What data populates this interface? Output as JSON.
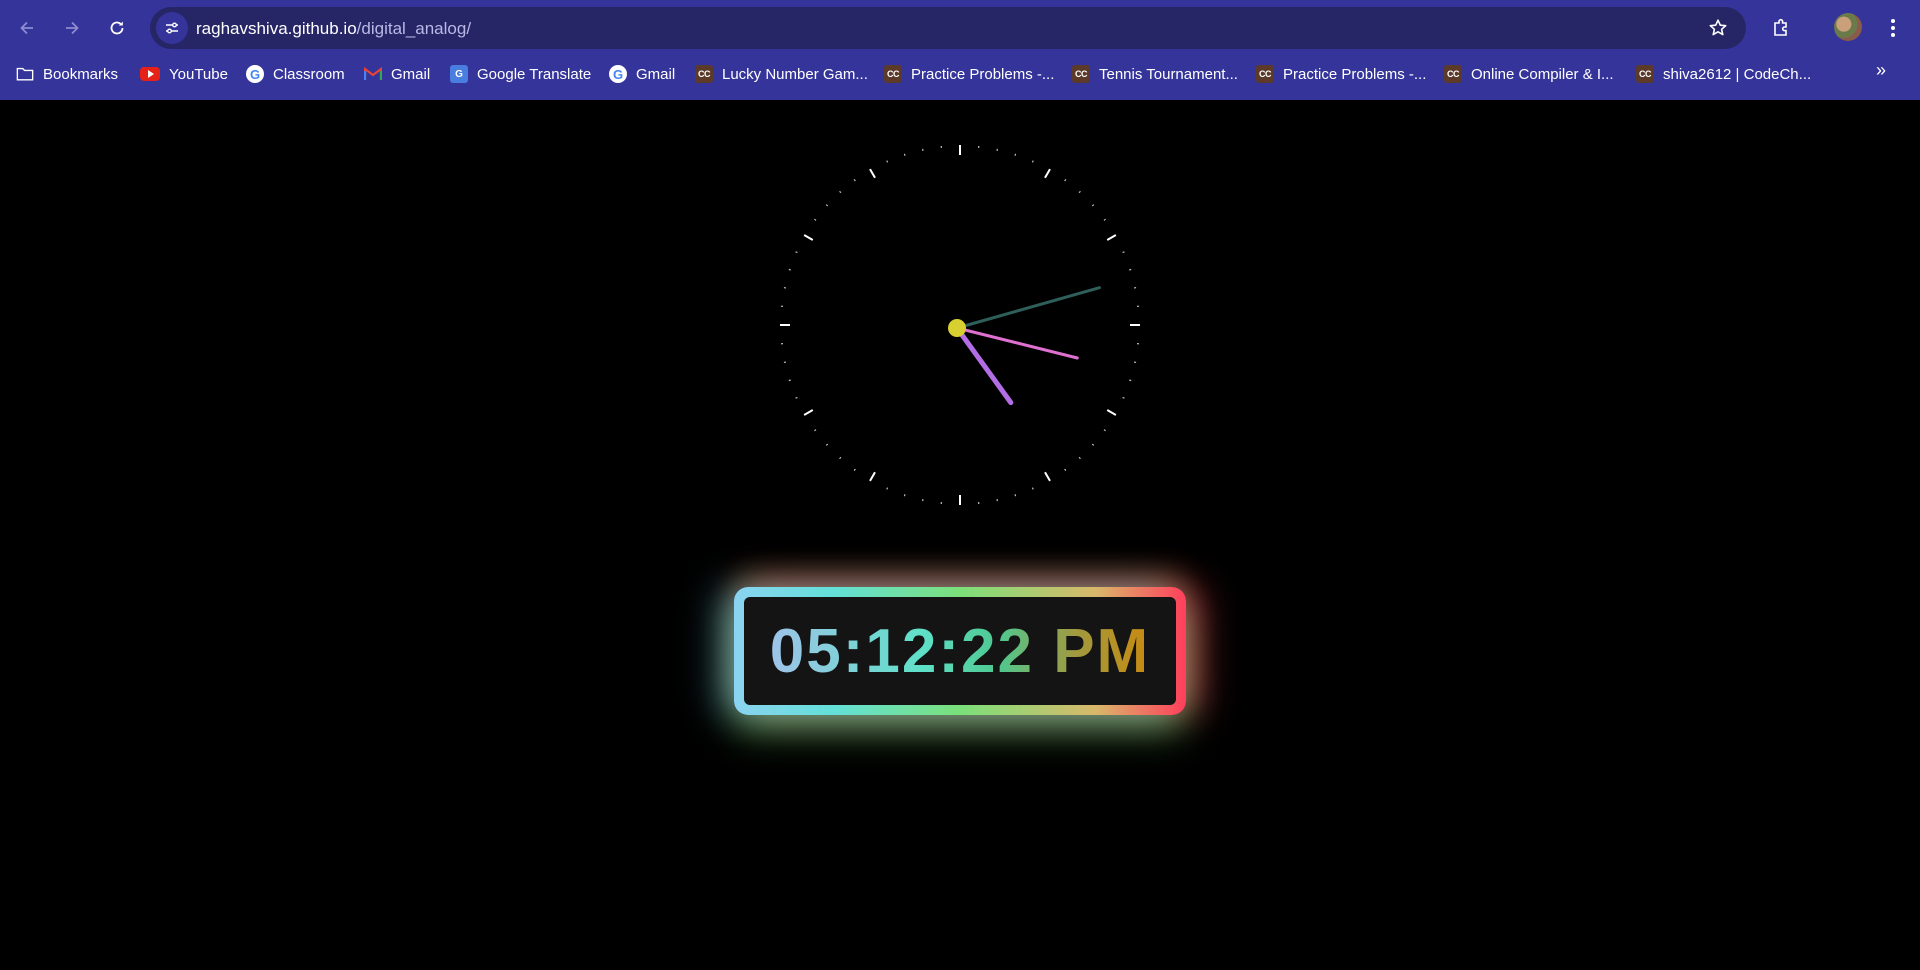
{
  "browser": {
    "url_host": "raghavshiva.github.io",
    "url_path": "/digital_analog/",
    "icons": {
      "back": "arrow-left",
      "forward": "arrow-right",
      "reload": "reload",
      "site_info": "tune",
      "bookmark_star": "star",
      "extensions": "puzzle",
      "menu": "kebab",
      "overflow": "double-chevron-right"
    }
  },
  "bookmarks": [
    {
      "label": "Bookmarks",
      "icon": "folder-icon"
    },
    {
      "label": "YouTube",
      "icon": "youtube-icon"
    },
    {
      "label": "Classroom",
      "icon": "google-icon"
    },
    {
      "label": "Gmail",
      "icon": "gmail-icon"
    },
    {
      "label": "Google Translate",
      "icon": "google-translate-icon"
    },
    {
      "label": "Gmail",
      "icon": "google-icon"
    },
    {
      "label": "Lucky Number Gam...",
      "icon": "codechef-icon"
    },
    {
      "label": "Practice Problems -...",
      "icon": "codechef-icon"
    },
    {
      "label": "Tennis Tournament...",
      "icon": "codechef-icon"
    },
    {
      "label": "Practice Problems -...",
      "icon": "codechef-icon"
    },
    {
      "label": "Online Compiler & I...",
      "icon": "codechef-icon"
    },
    {
      "label": "shiva2612 | CodeCh...",
      "icon": "codechef-icon"
    }
  ],
  "clock": {
    "hours": 5,
    "minutes": 12,
    "seconds": 22,
    "colors": {
      "hour_hand": "#b36ee6",
      "minute_hand": "#2f5f5a",
      "second_hand": "#e070d0",
      "center": "#d8d030",
      "ticks": "#ffffff"
    }
  },
  "digital": {
    "time": "05:12:22",
    "period": "PM"
  }
}
